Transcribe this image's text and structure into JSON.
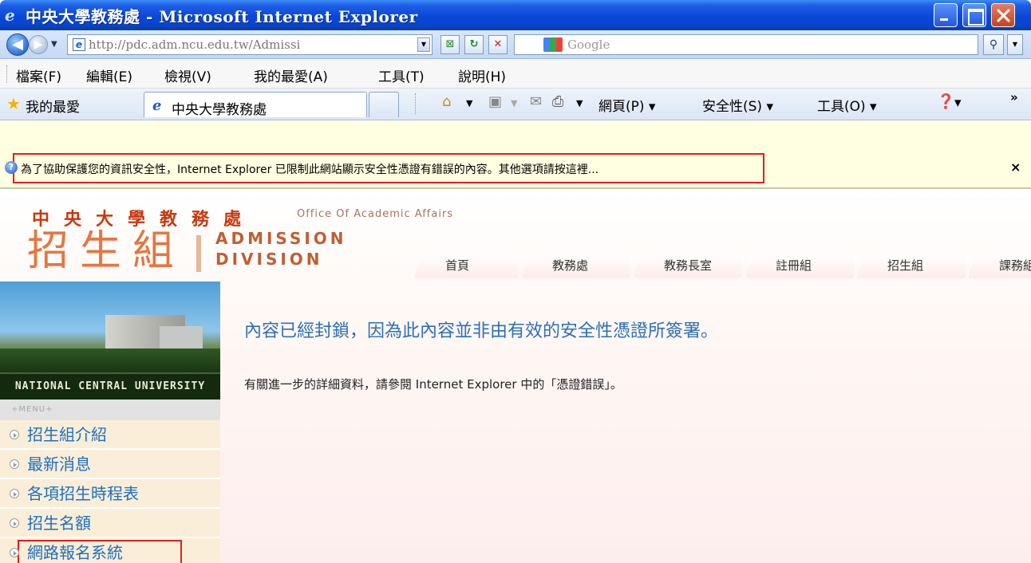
{
  "window": {
    "title": "中央大學教務處 - Microsoft Internet Explorer"
  },
  "address_bar": {
    "url": "http://pdc.adm.ncu.edu.tw/Admissi",
    "search_placeholder": "Google"
  },
  "menu_bar": {
    "items": [
      "檔案(F)",
      "編輯(E)",
      "檢視(V)",
      "我的最愛(A)",
      "工具(T)",
      "說明(H)"
    ]
  },
  "favorites_bar": {
    "favorites_label": "我的最愛",
    "tab_title": "中央大學教務處",
    "page_menu": "網頁(P) ▾",
    "safety_menu": "安全性(S) ▾",
    "tools_menu": "工具(O) ▾",
    "help_menu": "▾",
    "overflow": "»"
  },
  "info_bar": {
    "message": "為了協助保護您的資訊安全性，Internet Explorer 已限制此網站顯示安全性憑證有錯誤的內容。其他選項請按這裡...",
    "close": "×"
  },
  "page": {
    "brand_cn": "中央大學教務處",
    "brand_en": "Office Of Academic Affairs",
    "division_cn": "招生組",
    "division_en_1": "ADMISSION",
    "division_en_2": "DIVISION",
    "nav_tabs": [
      "首頁",
      "教務處",
      "教務長室",
      "註冊組",
      "招生組",
      "課務組"
    ],
    "photo_caption": "NATIONAL CENTRAL UNIVERSITY",
    "menu_header": "+MENU+",
    "sidebar_items": [
      "招生組介紹",
      "最新消息",
      "各項招生時程表",
      "招生名額",
      "網路報名系統"
    ],
    "blocked_message": "內容已經封鎖，因為此內容並非由有效的安全性憑證所簽署。",
    "blocked_detail": "有關進一步的詳細資料，請參閱 Internet Explorer 中的「憑證錯誤」。"
  },
  "colors": {
    "title_bar": "#0a48d6",
    "info_bar": "#ffffe1",
    "highlight_box": "#e01e1e",
    "link_blue": "#2e6fb4",
    "brand_orange": "#e4773f"
  }
}
